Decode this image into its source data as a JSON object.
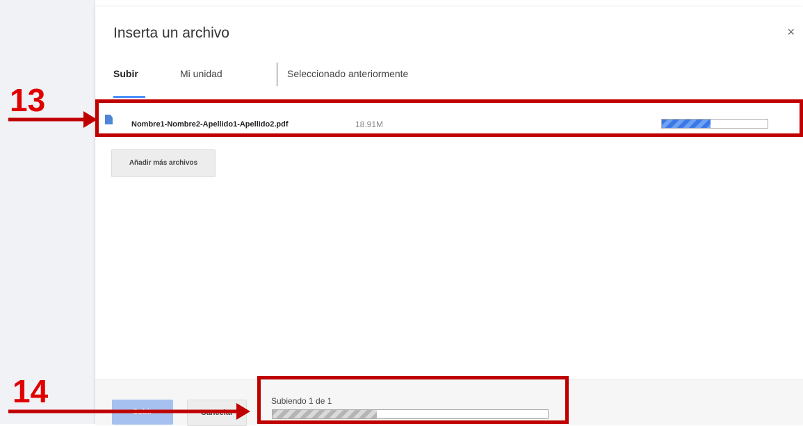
{
  "dialog": {
    "title": "Inserta un archivo",
    "close_icon": "×"
  },
  "tabs": [
    {
      "label": "Subir",
      "active": true
    },
    {
      "label": "Mi unidad",
      "active": false
    },
    {
      "label": "Seleccionado anteriormente",
      "active": false
    }
  ],
  "file": {
    "icon": "document-icon",
    "name": "Nombre1-Nombre2-Apellido1-Apellido2.pdf",
    "size": "18.91M",
    "progress": 0.46
  },
  "add_more_label": "Añadir más archivos",
  "footer": {
    "upload_label": "Subir",
    "cancel_label": "Cancelar",
    "status": "Subiendo 1 de 1",
    "overall_progress": 0.38
  },
  "annotations": {
    "step1": "13",
    "step2": "14",
    "color": "#c00000"
  }
}
